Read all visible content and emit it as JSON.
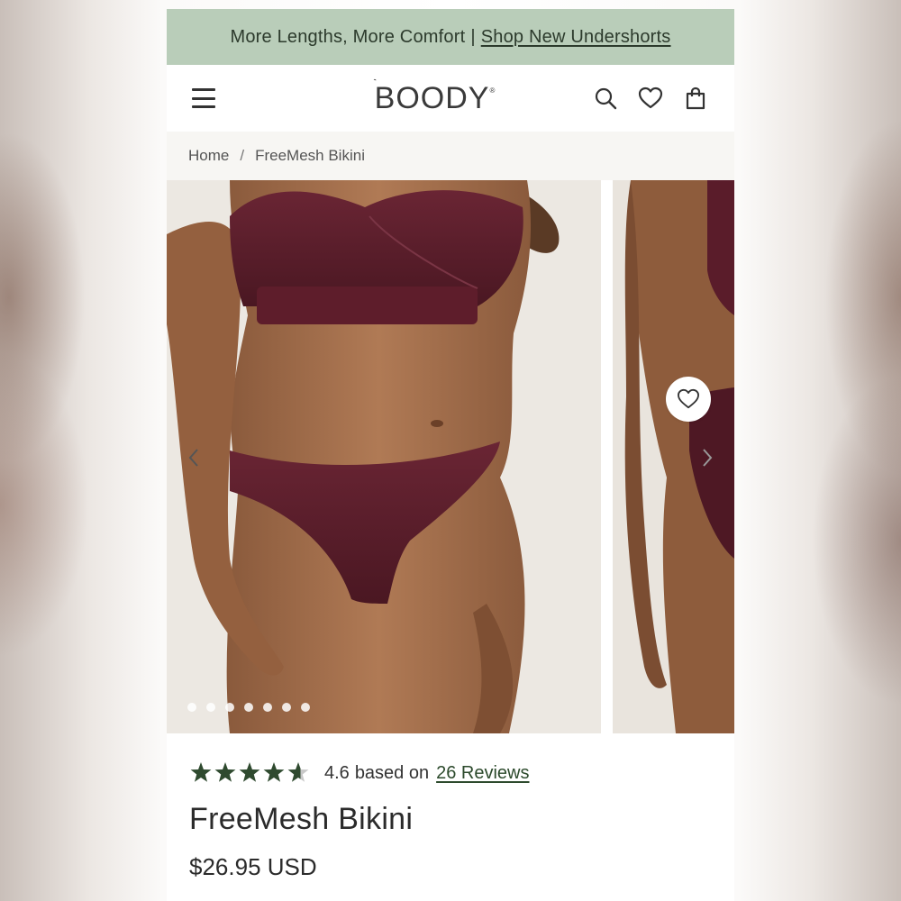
{
  "announcement": {
    "text": "More Lengths, More Comfort",
    "separator": "|",
    "link": "Shop New Undershorts"
  },
  "header": {
    "logo": "BOODY",
    "icons": [
      "menu-icon",
      "search-icon",
      "heart-icon",
      "bag-icon"
    ]
  },
  "breadcrumb": {
    "home": "Home",
    "separator": "/",
    "current": "FreeMesh Bikini"
  },
  "gallery": {
    "slide_count": 7,
    "active_slide": 4
  },
  "product": {
    "rating_value": 4.6,
    "rating_number": "4.6",
    "rating_based": "based on",
    "reviews_link": "26 Reviews",
    "title": "FreeMesh Bikini",
    "price": "$26.95 USD"
  },
  "colors": {
    "announcement_bg": "#b9cdb9",
    "star": "#2f4a2f",
    "garment": "#5a1f2b"
  }
}
